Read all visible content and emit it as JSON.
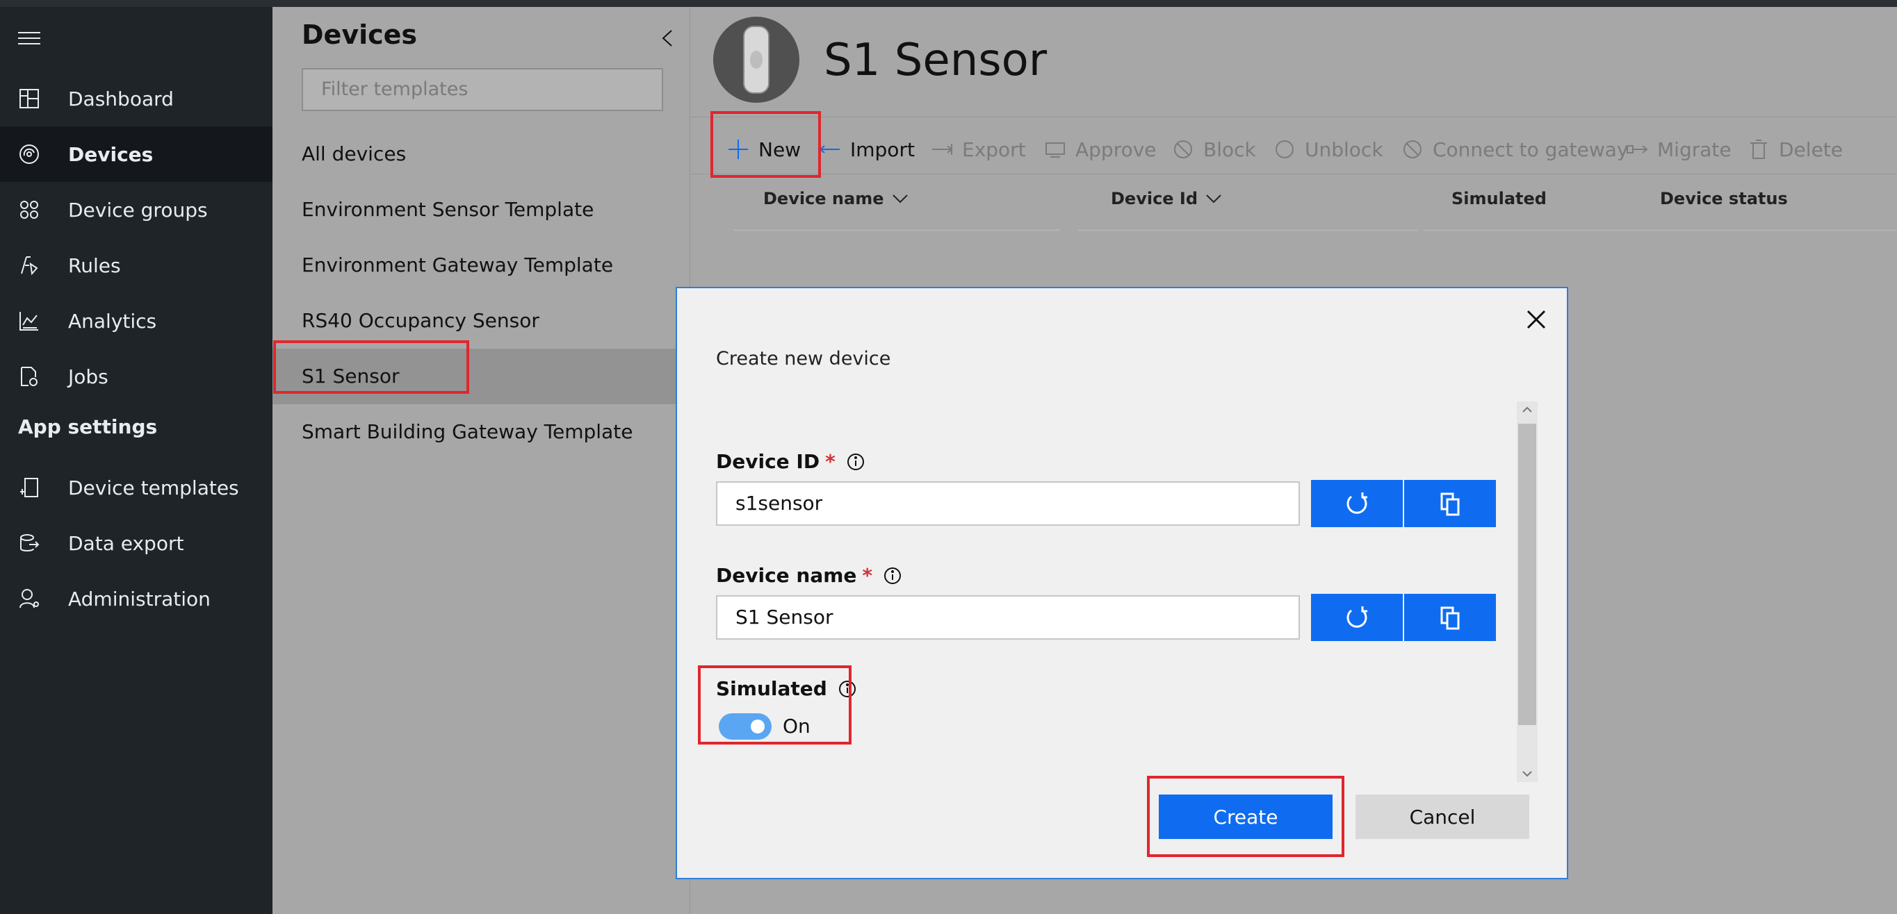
{
  "nav": {
    "items": [
      {
        "label": "Dashboard",
        "icon": "dashboard-icon"
      },
      {
        "label": "Devices",
        "icon": "devices-icon",
        "active": true
      },
      {
        "label": "Device groups",
        "icon": "device-groups-icon"
      },
      {
        "label": "Rules",
        "icon": "rules-icon"
      },
      {
        "label": "Analytics",
        "icon": "analytics-icon"
      },
      {
        "label": "Jobs",
        "icon": "jobs-icon"
      }
    ],
    "section_label": "App settings",
    "settings_items": [
      {
        "label": "Device templates",
        "icon": "device-templates-icon"
      },
      {
        "label": "Data export",
        "icon": "data-export-icon"
      },
      {
        "label": "Administration",
        "icon": "administration-icon"
      }
    ]
  },
  "templates": {
    "title": "Devices",
    "filter_placeholder": "Filter templates",
    "items": [
      "All devices",
      "Environment Sensor Template",
      "Environment Gateway Template",
      "RS40 Occupancy Sensor",
      "S1 Sensor",
      "Smart Building Gateway Template"
    ],
    "selected": "S1 Sensor"
  },
  "header": {
    "title": "S1 Sensor"
  },
  "toolbar": {
    "new": "New",
    "import": "Import",
    "export": "Export",
    "approve": "Approve",
    "block": "Block",
    "unblock": "Unblock",
    "connect": "Connect to gateway",
    "migrate": "Migrate",
    "delete": "Delete"
  },
  "table": {
    "columns": [
      "Device name",
      "Device Id",
      "Simulated",
      "Device status"
    ]
  },
  "dialog": {
    "title": "Create new device",
    "device_id_label": "Device ID",
    "device_id_value": "s1sensor",
    "device_name_label": "Device name",
    "device_name_value": "S1 Sensor",
    "required_mark": "*",
    "simulated_label": "Simulated",
    "simulated_state": "On",
    "simulated_on": true,
    "create_label": "Create",
    "cancel_label": "Cancel"
  },
  "colors": {
    "accent": "#0f6cf0",
    "highlight": "#e0262e",
    "nav_bg": "#1f2429",
    "required": "#d13438"
  }
}
